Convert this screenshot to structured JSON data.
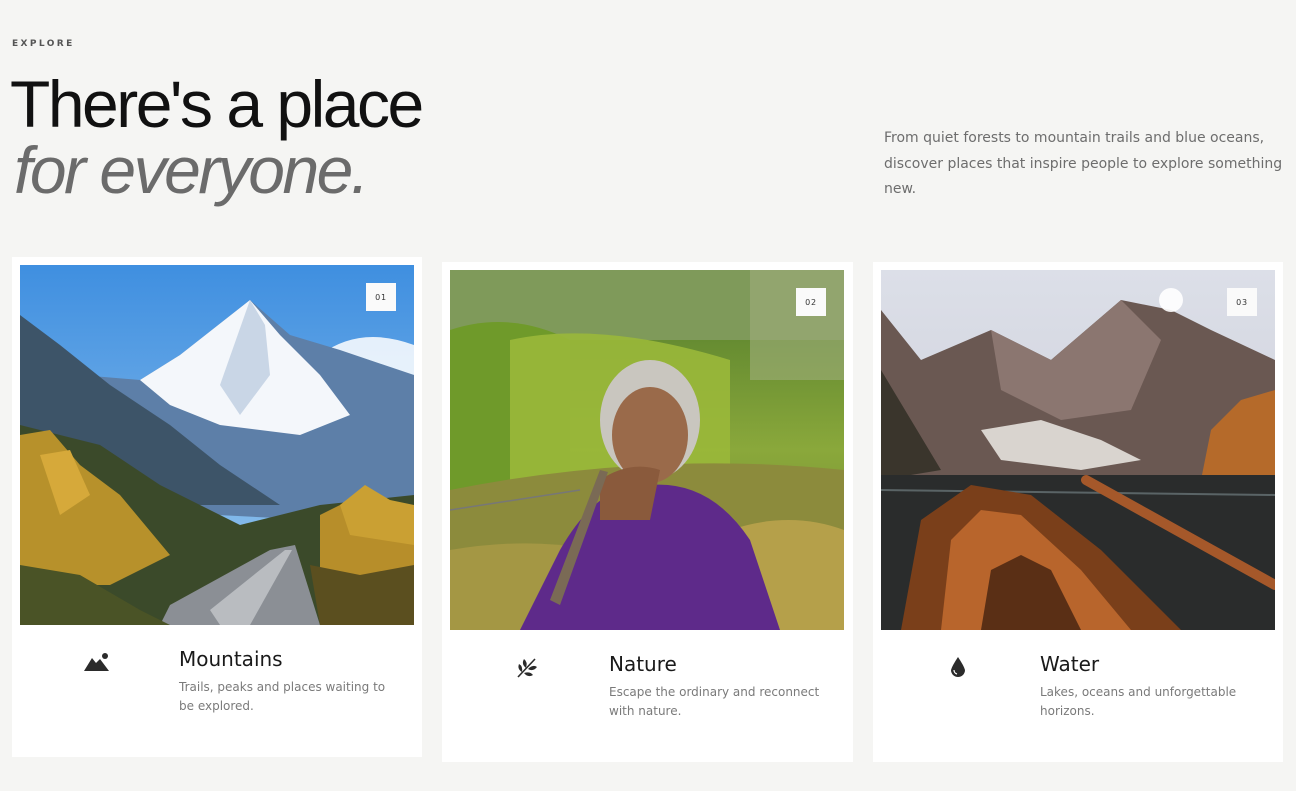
{
  "header": {
    "eyebrow": "EXPLORE",
    "title_line1": "There's a place",
    "title_line2": "for everyone.",
    "intro": "From quiet forests to mountain trails and blue oceans, discover places that inspire people to explore something new."
  },
  "cards": [
    {
      "number": "01",
      "title": "Mountains",
      "description": "Trails, peaks and places waiting to be explored.",
      "icon": "mountain-icon",
      "image": "snowy mountain above autumn forest and road"
    },
    {
      "number": "02",
      "title": "Nature",
      "description": "Escape the ordinary and reconnect with nature.",
      "icon": "leaf-icon",
      "image": "smiling elderly woman in green field"
    },
    {
      "number": "03",
      "title": "Water",
      "description": "Lakes, oceans and unforgettable horizons.",
      "icon": "water-drop-icon",
      "image": "wooden rowboat on mountain lake"
    }
  ],
  "colors": {
    "background": "#f5f5f3",
    "card": "#ffffff",
    "heading": "#111111",
    "heading_italic": "#6b6b6b",
    "body_text": "#7a7a7a"
  }
}
